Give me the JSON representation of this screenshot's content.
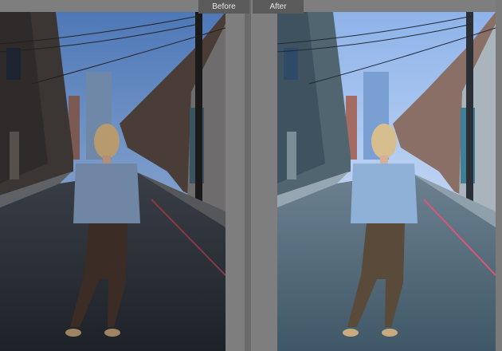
{
  "compare": {
    "before_label": "Before",
    "after_label": "After"
  },
  "colors": {
    "panel_background": "#7e7e7e",
    "label_background": "#5a5a5a",
    "label_text": "#e6e6e6",
    "before_sky": "#6f93c4",
    "after_sky": "#c7dbf2"
  },
  "icons": {
    "before_photo": "street-portrait-photo",
    "after_photo": "street-portrait-photo-edited"
  }
}
